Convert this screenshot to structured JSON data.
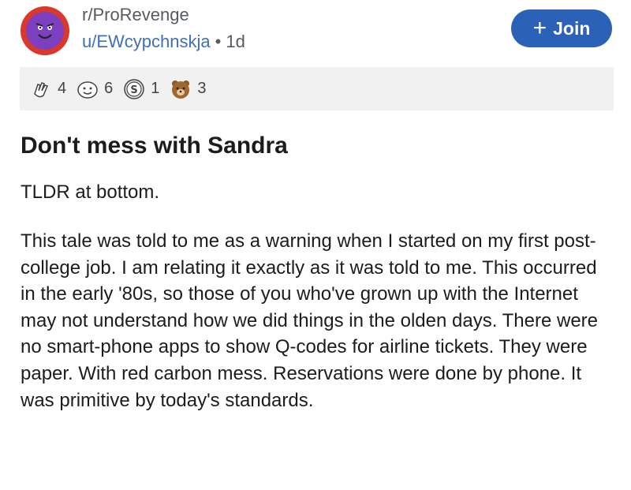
{
  "post": {
    "subreddit": "r/ProRevenge",
    "username": "u/EWcypchnskja",
    "separator": "•",
    "age": "1d",
    "join_label": "Join",
    "join_icon": "+",
    "title": "Don't mess with Sandra",
    "tldr": "TLDR at bottom.",
    "body": "This tale was told to me as a warning when I started on my first post-college job. I am relating it exactly as it was told to me. This occurred in the early '80s, so those of you who've grown up with the Internet may not understand how we did things in the olden days. There were no smart-phone apps to show Q-codes for airline tickets. They were paper. With red carbon mess. Reservations were done by phone. It was primitive by today's standards."
  },
  "awards": [
    {
      "icon": "clapping-hands-award-icon",
      "count": "4"
    },
    {
      "icon": "face-award-icon",
      "count": "6"
    },
    {
      "icon": "silver-coin-award-icon",
      "count": "1"
    },
    {
      "icon": "bear-award-icon",
      "count": "3"
    }
  ],
  "colors": {
    "join_button": "#2b62b8",
    "username": "#3f6fb6",
    "avatar_ring": "#d9382b",
    "avatar_face": "#7b3fbf",
    "awards_bar": "#f1f1f1"
  }
}
